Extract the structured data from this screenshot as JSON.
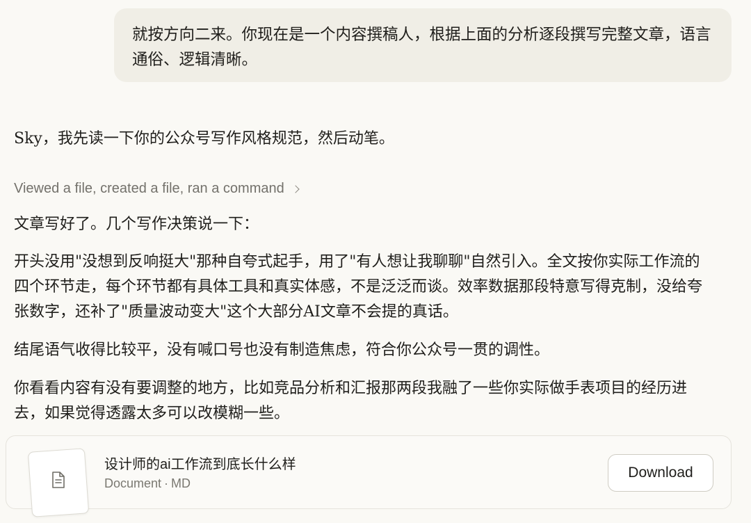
{
  "user_message": {
    "text": "就按方向二来。你现在是一个内容撰稿人，根据上面的分析逐段撰写完整文章，语言通俗、逻辑清晰。"
  },
  "assistant": {
    "intro": "Sky，我先读一下你的公众号写作风格规范，然后动笔。",
    "tool_summary": "Viewed a file, created a file, ran a command",
    "paragraphs": [
      "文章写好了。几个写作决策说一下：",
      "开头没用\"没想到反响挺大\"那种自夸式起手，用了\"有人想让我聊聊\"自然引入。全文按你实际工作流的四个环节走，每个环节都有具体工具和真实体感，不是泛泛而谈。效率数据那段特意写得克制，没给夸张数字，还补了\"质量波动变大\"这个大部分AI文章不会提的真话。",
      "结尾语气收得比较平，没有喊口号也没有制造焦虑，符合你公众号一贯的调性。",
      "你看看内容有没有要调整的地方，比如竞品分析和汇报那两段我融了一些你实际做手表项目的经历进去，如果觉得透露太多可以改模糊一些。"
    ]
  },
  "file_card": {
    "title": "设计师的ai工作流到底长什么样",
    "type": "Document",
    "separator": "·",
    "format": "MD",
    "icon": "document-icon",
    "download_label": "Download"
  },
  "colors": {
    "background": "#faf9f5",
    "user_bubble": "#f0eee6",
    "muted_text": "#73716b"
  }
}
